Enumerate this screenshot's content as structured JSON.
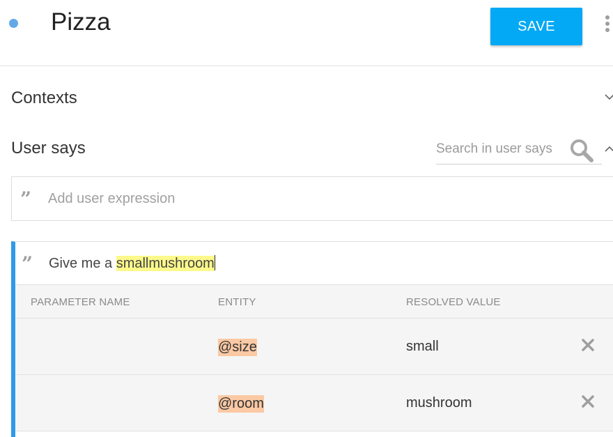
{
  "header": {
    "title": "Pizza",
    "save_label": "SAVE"
  },
  "sections": {
    "contexts_label": "Contexts",
    "user_says_label": "User says"
  },
  "search": {
    "placeholder": "Search in user says",
    "value": ""
  },
  "add_expression": {
    "placeholder": "Add user expression",
    "value": ""
  },
  "expression": {
    "plain_text": "Give me a ",
    "highlighted_text": "smallmushroom"
  },
  "parameter_table": {
    "headers": {
      "name": "PARAMETER NAME",
      "entity": "ENTITY",
      "value": "RESOLVED VALUE"
    },
    "rows": [
      {
        "name": "",
        "entity": "@size",
        "value": "small"
      },
      {
        "name": "",
        "entity": "@room",
        "value": "mushroom"
      }
    ]
  },
  "colors": {
    "accent": "#03a9f4",
    "card_border": "#2f9ae8",
    "highlight": "#fdf98a",
    "entity_chip": "#fbc9a4"
  },
  "icons": [
    "status-dot",
    "more-vert-icon",
    "chevron-down-icon",
    "chevron-up-icon",
    "search-icon",
    "quote-icon",
    "close-icon"
  ]
}
